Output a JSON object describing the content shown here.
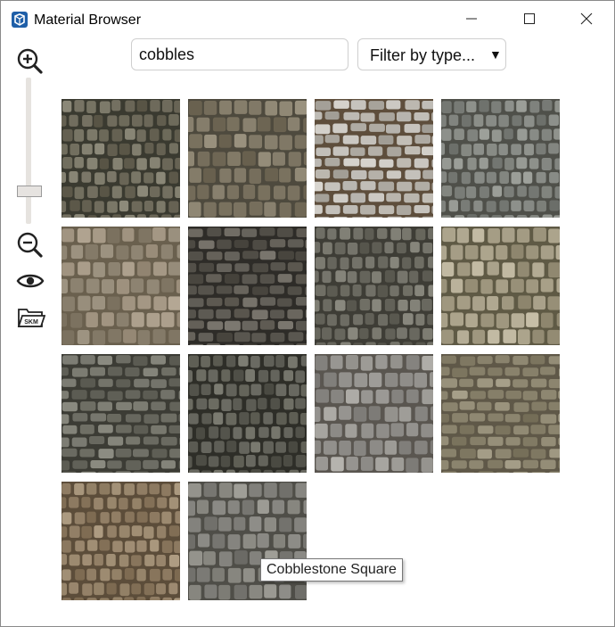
{
  "window": {
    "title": "Material Browser"
  },
  "app_icon": "sketchup-icon",
  "search": {
    "value": "cobbles"
  },
  "filter": {
    "label": "Filter by type...",
    "arrow": "▼"
  },
  "toolbar": {
    "zoom_in": "zoom-in-icon",
    "zoom_slider": {
      "level": 0.2
    },
    "zoom_out": "zoom-out-icon",
    "preview": "eye-icon",
    "open_skm": {
      "icon": "skm-folder-icon",
      "label": "SKM"
    }
  },
  "materials": [
    {
      "base": "#6a6657",
      "grout": "#3a3a30",
      "accent": "#7d7a6a"
    },
    {
      "base": "#7a7260",
      "grout": "#4e4a3e",
      "accent": "#8b8370"
    },
    {
      "base": "#b0aca4",
      "grout": "#5e4e3c",
      "accent": "#c8c5bf"
    },
    {
      "base": "#7c7f7a",
      "grout": "#4f504a",
      "accent": "#8d908a"
    },
    {
      "base": "#8c8270",
      "grout": "#6a604e",
      "accent": "#a39683"
    },
    {
      "base": "#57544d",
      "grout": "#2e2c28",
      "accent": "#6a665e"
    },
    {
      "base": "#67665d",
      "grout": "#3e3d36",
      "accent": "#77766c"
    },
    {
      "base": "#9f977f",
      "grout": "#5f5a45",
      "accent": "#b5ad96"
    },
    {
      "base": "#6b6b62",
      "grout": "#3c3c35",
      "accent": "#7b7b71"
    },
    {
      "base": "#5a5a52",
      "grout": "#2e2e28",
      "accent": "#6c6c62"
    },
    {
      "base": "#8c8a86",
      "grout": "#5a5650",
      "accent": "#a3a19c"
    },
    {
      "base": "#857e68",
      "grout": "#5f5848",
      "accent": "#958e78"
    },
    {
      "base": "#8e7b62",
      "grout": "#5c4d3a",
      "accent": "#9c8a70"
    },
    {
      "base": "#7d7c77",
      "grout": "#4f4e48",
      "accent": "#8e8d86"
    }
  ],
  "tooltip": {
    "text": "Cobblestone Square"
  },
  "colors": {
    "window_bg": "#ffffff",
    "border": "#cfcfcf",
    "slider": "#e6e3df"
  }
}
